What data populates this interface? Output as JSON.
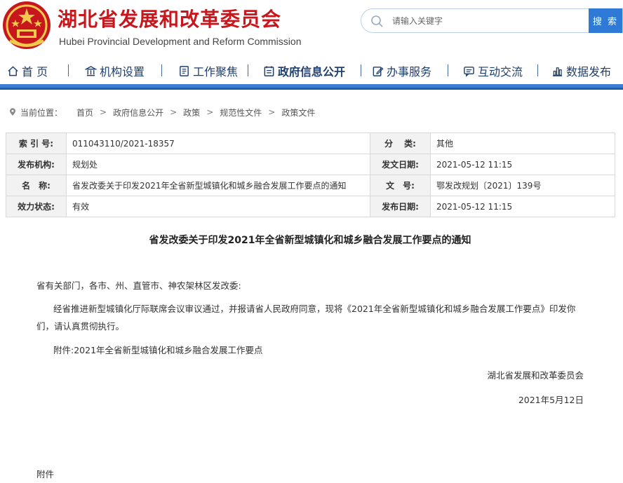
{
  "header": {
    "site_title": "湖北省发展和改革委员会",
    "site_subtitle": "Hubei Provincial Development and Reform Commission",
    "search_placeholder": "请输入关键字",
    "search_button": "搜 索"
  },
  "nav": {
    "items": [
      {
        "label": "首 页",
        "icon": "home-icon"
      },
      {
        "label": "机构设置",
        "icon": "building-icon"
      },
      {
        "label": "工作聚焦",
        "icon": "document-icon"
      },
      {
        "label": "政府信息公开",
        "icon": "list-icon",
        "active": true
      },
      {
        "label": "办事服务",
        "icon": "edit-icon"
      },
      {
        "label": "互动交流",
        "icon": "chat-icon"
      },
      {
        "label": "数据发布",
        "icon": "bar-chart-icon"
      }
    ]
  },
  "breadcrumb": {
    "label": "当前位置：",
    "items": [
      "首页",
      "政府信息公开",
      "政策",
      "规范性文件",
      "政策文件"
    ]
  },
  "info": {
    "index_label": "索 引 号:",
    "index_value": "011043110/2021-18357",
    "category_label": "分　 类:",
    "category_value": "其他",
    "org_label": "发布机构:",
    "org_value": "规划处",
    "doc_date_label": "发文日期:",
    "doc_date_value": "2021-05-12 11:15",
    "name_label": "名　称:",
    "name_value": "省发改委关于印发2021年全省新型城镇化和城乡融合发展工作要点的通知",
    "doc_no_label": "文　号:",
    "doc_no_value": "鄂发改规划〔2021〕139号",
    "status_label": "效力状态:",
    "status_value": "有效",
    "pub_date_label": "发布日期:",
    "pub_date_value": "2021-05-12 11:15"
  },
  "article": {
    "title": "省发改委关于印发2021年全省新型城镇化和城乡融合发展工作要点的通知",
    "salutation": "省有关部门，各市、州、直管市、神农架林区发改委:",
    "body": "经省推进新型城镇化厅际联席会议审议通过，并报请省人民政府同意，现将《2021年全省新型城镇化和城乡融合发展工作要点》印发你们，请认真贯彻执行。",
    "attachment": "附件:2021年全省新型城镇化和城乡融合发展工作要点",
    "signature": "湖北省发展和改革委员会",
    "date": "2021年5月12日",
    "attachment_heading": "附件"
  },
  "colors": {
    "brand_red": "#c8161d",
    "nav_blue": "#3a7fd4",
    "search_blue": "#2e7ad6",
    "nav_text": "#1f3f6d"
  }
}
